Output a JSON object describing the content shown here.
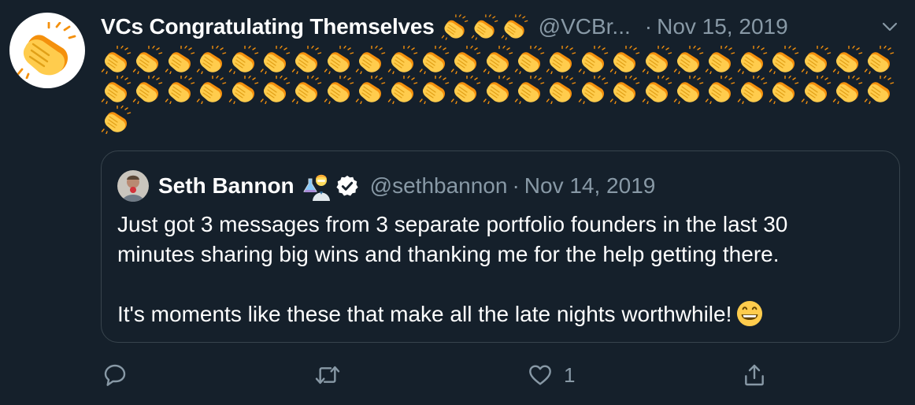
{
  "tweet": {
    "display_name": "VCs Congratulating Themselves",
    "handle": "@VCBr...",
    "separator": "·",
    "date": "Nov 15, 2019",
    "name_emoji": "clapping-hands",
    "name_emoji_count": 3,
    "body_emoji": "clapping-hands",
    "body_emoji_count": 51,
    "menu_icon": "chevron-down-icon"
  },
  "quote": {
    "display_name": "Seth Bannon",
    "handle": "@sethbannon",
    "separator": "·",
    "date": "Nov 14, 2019",
    "name_emoji": "scientist",
    "verified": true,
    "text_lines": [
      "Just got 3 messages from 3 separate portfolio founders in the last 30",
      "minutes sharing big wins and thanking me for the help getting there.",
      "It's moments like these that make all the late nights worthwhile!"
    ],
    "trailing_emoji": "grinning-face"
  },
  "actions": {
    "reply": {
      "icon": "reply-icon",
      "count": ""
    },
    "retweet": {
      "icon": "retweet-icon",
      "count": ""
    },
    "like": {
      "icon": "heart-icon",
      "count": "1"
    },
    "share": {
      "icon": "share-icon",
      "count": ""
    }
  },
  "colors": {
    "background": "#15202b",
    "text": "#ffffff",
    "secondary": "#8899a6",
    "border": "#38444d",
    "clap": "#fcc21b"
  }
}
